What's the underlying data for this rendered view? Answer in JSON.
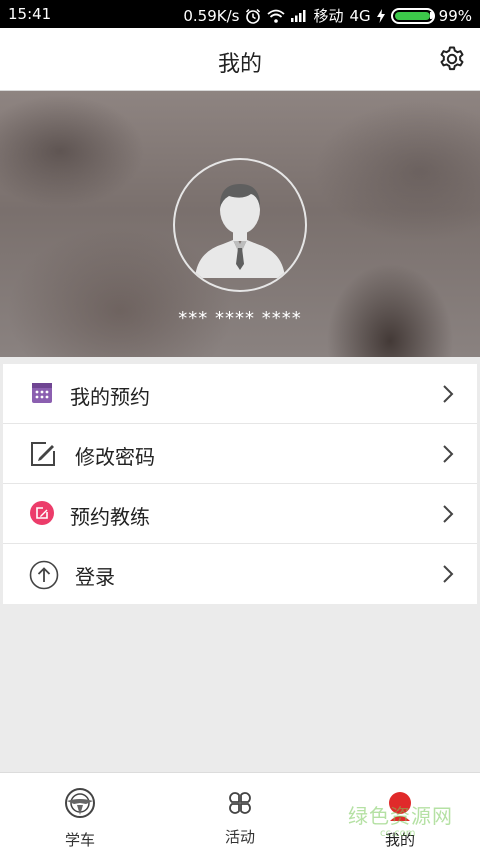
{
  "status_bar": {
    "time": "15:41",
    "speed": "0.59K/s",
    "carrier": "移动",
    "network": "4G",
    "battery": "99%",
    "battery_level": 0.99
  },
  "header": {
    "title": "我的",
    "settings_icon": "gear-icon"
  },
  "profile": {
    "masked_phone": "*** **** ****",
    "avatar_icon": "user-avatar-icon"
  },
  "menu": {
    "items": [
      {
        "label": "我的预约",
        "icon": "calendar-icon",
        "color": "#8b5fb0"
      },
      {
        "label": "修改密码",
        "icon": "edit-icon",
        "color": "#444444"
      },
      {
        "label": "预约教练",
        "icon": "coach-book-icon",
        "color": "#ec3c6a"
      },
      {
        "label": "登录",
        "icon": "arrow-up-circle-icon",
        "color": "#444444"
      }
    ]
  },
  "tabs": [
    {
      "label": "学车",
      "icon": "steering-wheel-icon"
    },
    {
      "label": "活动",
      "icon": "clover-icon"
    },
    {
      "label": "我的",
      "icon": "person-icon",
      "active": true
    }
  ],
  "watermark": {
    "text": "绿色资源网",
    "sub": "cc.com"
  }
}
